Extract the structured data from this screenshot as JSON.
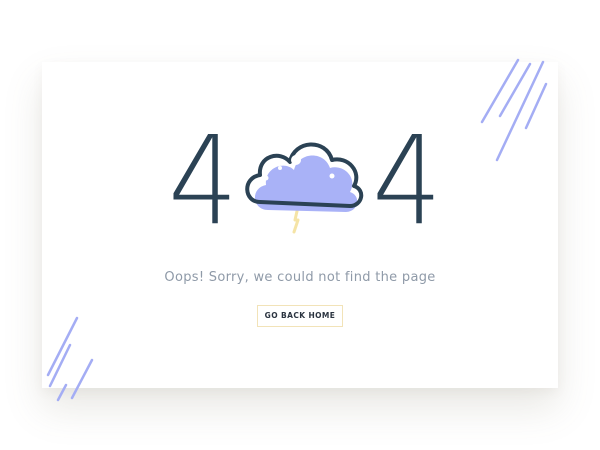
{
  "error_code": {
    "first_digit": "4",
    "last_digit": "4"
  },
  "message": "Oops! Sorry, we could not find the page",
  "button": {
    "label": "GO BACK HOME"
  },
  "icons": {
    "zero_glyph": "storm-cloud-icon",
    "decoration": "rain-streaks"
  },
  "colors": {
    "digit": "#2b4254",
    "cloud_fill": "#a9b2f7",
    "cloud_outline": "#2b4254",
    "rain": "#a4adf4",
    "message": "#8f9aa8",
    "button_border": "#f2e3b8"
  }
}
